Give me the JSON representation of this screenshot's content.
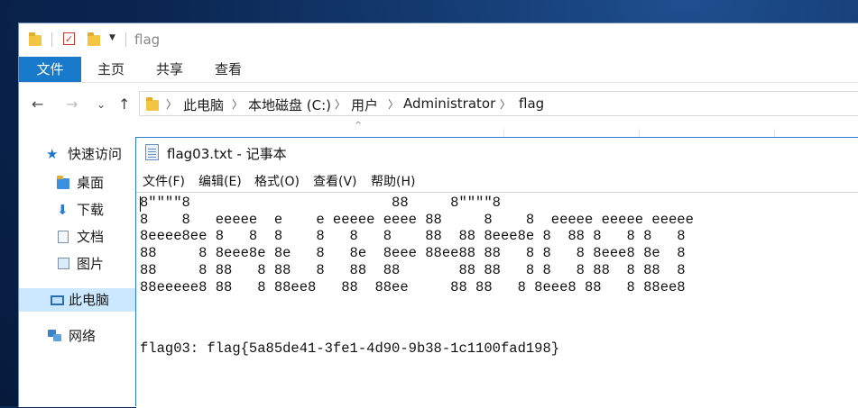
{
  "explorer": {
    "title": "flag",
    "ribbon_tabs": [
      "文件",
      "主页",
      "共享",
      "查看"
    ],
    "breadcrumb": [
      "此电脑",
      "本地磁盘 (C:)",
      "用户",
      "Administrator",
      "flag"
    ],
    "sidebar": {
      "quick_access": "快速访问",
      "items": [
        "桌面",
        "下载",
        "文档",
        "图片"
      ],
      "this_pc": "此电脑",
      "network": "网络"
    }
  },
  "notepad": {
    "title": "flag03.txt - 记事本",
    "menu": [
      "文件(F)",
      "编辑(E)",
      "格式(O)",
      "查看(V)",
      "帮助(H)"
    ],
    "ascii_art": "8\"\"\"\"8                        88     8\"\"\"\"8\n8    8   eeeee  e    e eeeee eeee 88     8    8  eeeee eeeee eeeee\n8eeee8ee 8   8  8    8   8   8    88  88 8eee8e 8  88 8   8 8   8\n88     8 8eee8e 8e   8   8e  8eee 88ee88 88   8 8   8 8eee8 8e  8\n88     8 88   8 88   8   88  88       88 88   8 8   8 88  8 88  8\n88eeeee8 88   8 88ee8   88  88ee     88 88   8 8eee8 88   8 88ee8",
    "flag_line": "flag03: flag{5a85de41-3fe1-4d90-9b38-1c1100fad198}"
  }
}
